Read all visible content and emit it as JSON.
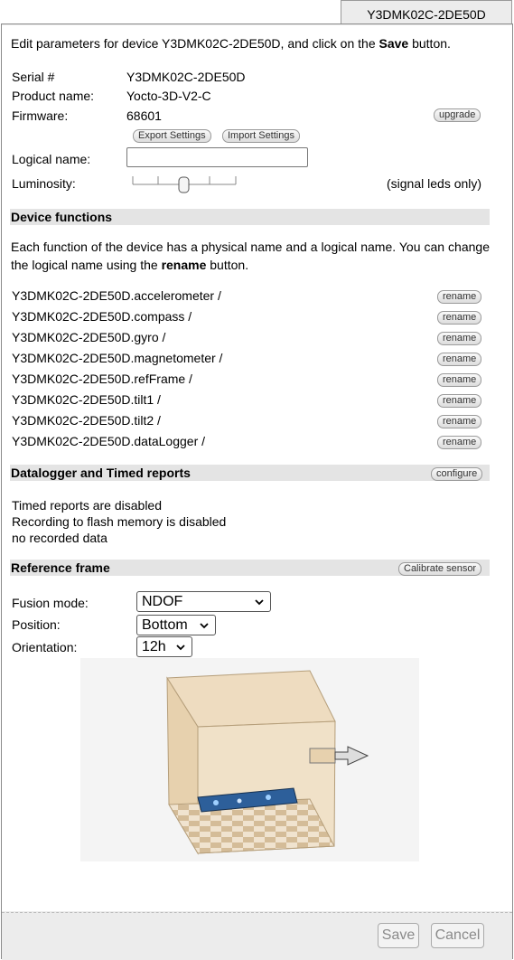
{
  "tab": {
    "title": "Y3DMK02C-2DE50D"
  },
  "intro": {
    "before": "Edit parameters for device Y3DMK02C-2DE50D, and click on the ",
    "bold": "Save",
    "after": " button."
  },
  "info": {
    "serial_label": "Serial #",
    "serial_value": "Y3DMK02C-2DE50D",
    "product_label": "Product name:",
    "product_value": "Yocto-3D-V2-C",
    "firmware_label": "Firmware:",
    "firmware_value": "68601",
    "upgrade": "upgrade",
    "export": "Export Settings",
    "import": "Import Settings",
    "logical_label": "Logical name:",
    "logical_value": "",
    "luminosity_label": "Luminosity:",
    "luminosity_note": "(signal leds only)"
  },
  "functions": {
    "header": "Device functions",
    "para_before": "Each function of the device has a physical name and a logical name. You can change the logical name using the ",
    "para_bold": "rename",
    "para_after": " button.",
    "rename_label": "rename",
    "items": [
      "Y3DMK02C-2DE50D.accelerometer /",
      "Y3DMK02C-2DE50D.compass /",
      "Y3DMK02C-2DE50D.gyro /",
      "Y3DMK02C-2DE50D.magnetometer /",
      "Y3DMK02C-2DE50D.refFrame /",
      "Y3DMK02C-2DE50D.tilt1 /",
      "Y3DMK02C-2DE50D.tilt2 /",
      "Y3DMK02C-2DE50D.dataLogger /"
    ]
  },
  "datalogger": {
    "header": "Datalogger and Timed reports",
    "configure": "configure",
    "lines": [
      "Timed reports are disabled",
      "Recording to flash memory is disabled",
      "no recorded data"
    ]
  },
  "refframe": {
    "header": "Reference frame",
    "calibrate": "Calibrate sensor",
    "fusion_label": "Fusion mode:",
    "fusion_value": "NDOF",
    "position_label": "Position:",
    "position_value": "Bottom",
    "orientation_label": "Orientation:",
    "orientation_value": "12h"
  },
  "footer": {
    "save": "Save",
    "cancel": "Cancel"
  }
}
